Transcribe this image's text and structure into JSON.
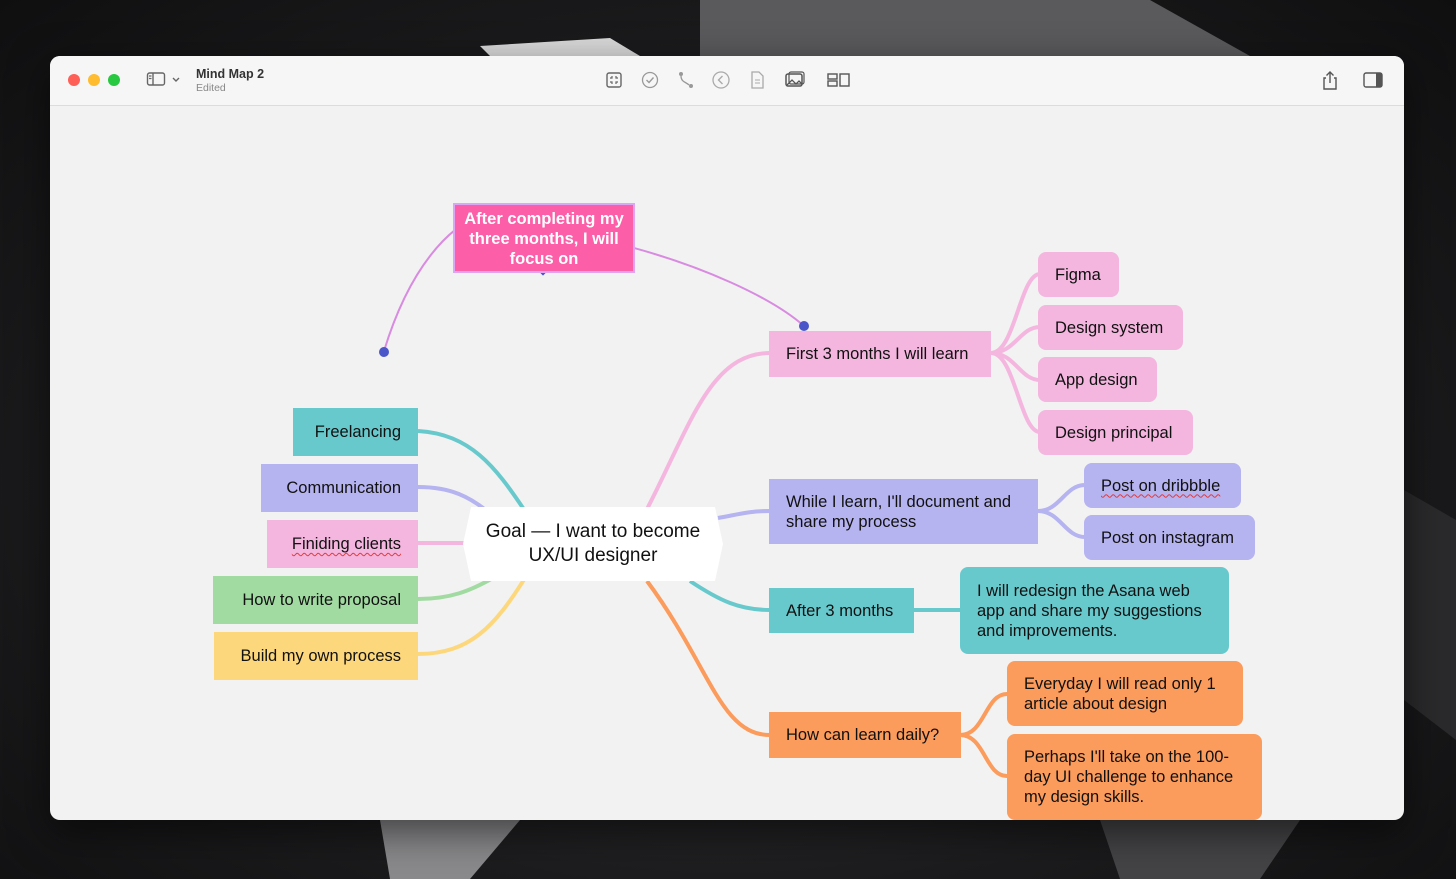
{
  "app": {
    "title": "Mind Map 2",
    "status": "Edited",
    "toolbar_icons": [
      "sidebar-icon",
      "chevron-down-icon",
      "focus-icon",
      "checkmark-icon",
      "relationship-icon",
      "back-icon",
      "document-icon",
      "image-icon",
      "layout-icon",
      "share-icon",
      "inspector-icon"
    ]
  },
  "colors": {
    "pink": "#f4b6df",
    "purple": "#b5b3f0",
    "teal": "#68c9cd",
    "orange": "#fb9b5c",
    "green": "#a2dba2",
    "yellow": "#fdd77c",
    "hot_pink": "#fc5fa8",
    "relation_line": "#d88be0",
    "handle": "#4b56c9"
  },
  "mindmap": {
    "root": {
      "line1": "Goal — I want to become",
      "line2": "UX/UI designer"
    },
    "floating": {
      "line1": "After completing my",
      "line2": "three months, I will",
      "line3": "focus on"
    },
    "left": [
      {
        "label": "Freelancing"
      },
      {
        "label": "Communication"
      },
      {
        "label": "Finiding clients"
      },
      {
        "label": "How to write proposal"
      },
      {
        "label": "Build my own process"
      }
    ],
    "first_months": {
      "label": "First 3 months I will learn",
      "children": [
        {
          "label": "Figma"
        },
        {
          "label": "Design system"
        },
        {
          "label": "App design"
        },
        {
          "label": "Design principal"
        }
      ]
    },
    "while_learn": {
      "line1": "While I learn, I'll document and",
      "line2": "share my process",
      "children": [
        {
          "label": "Post on dribbble"
        },
        {
          "label": "Post on instagram"
        }
      ]
    },
    "after_3": {
      "label": "After 3 months",
      "child": {
        "line1": "I will redesign the Asana web",
        "line2": "app and share my suggestions",
        "line3": "and improvements."
      }
    },
    "daily": {
      "label": "How can learn daily?",
      "children": [
        {
          "line1": "Everyday I will read only 1",
          "line2": "article about design"
        },
        {
          "line1": "Perhaps I'll take on the 100-",
          "line2": "day UI challenge to enhance",
          "line3": "my design skills."
        }
      ]
    }
  }
}
